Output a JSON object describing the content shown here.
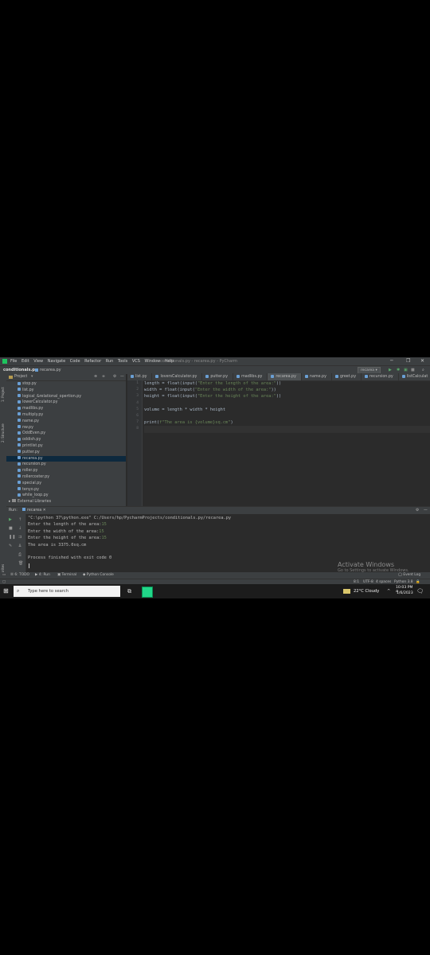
{
  "window": {
    "title": "conditionals.py - recarea.py - PyCharm",
    "menu": [
      "File",
      "Edit",
      "View",
      "Navigate",
      "Code",
      "Refactor",
      "Run",
      "Tools",
      "VCS",
      "Window",
      "Help"
    ]
  },
  "navbar": {
    "project": "conditionals.py",
    "file": "recarea.py",
    "run_config": "recarea"
  },
  "left_strip": {
    "project_label": "1: Project",
    "structure_label": "2: Structure",
    "favorites_label": "2: Favorites"
  },
  "project_panel": {
    "title": "Project",
    "files": [
      "stop.py",
      "list.py",
      "logical_&relational_opertion.py",
      "lowerCalculator.py",
      "madlibs.py",
      "multiply.py",
      "name.py",
      "nw.py",
      "OddEven.py",
      "oddish.py",
      "printlist.py",
      "putter.py",
      "recarea.py",
      "recursion.py",
      "roller.py",
      "rollercoster.py",
      "special.py",
      "tenyo.py",
      "while_loop.py"
    ],
    "selected": "recarea.py",
    "external": "External Libraries"
  },
  "tabs": [
    "list.py",
    "loversCalculator.py",
    "putter.py",
    "madlibs.py",
    "recarea.py",
    "name.py",
    "greet.py",
    "recursion.py",
    "listCalculat"
  ],
  "active_tab": "recarea.py",
  "editor": {
    "line_numbers": [
      "1",
      "2",
      "3",
      "4",
      "5",
      "6",
      "7",
      "8"
    ],
    "lines": [
      [
        "length = float(input(",
        "\"Enter the length of the area:\"",
        "))"
      ],
      [
        "width = float(input(",
        "\"Enter the width of the area:\"",
        "))"
      ],
      [
        "height = float(input(",
        "\"Enter the height of the area:\"",
        "))"
      ],
      [
        "",
        "",
        ""
      ],
      [
        "volume = length * width * height",
        "",
        ""
      ],
      [
        "",
        "",
        ""
      ],
      [
        "print(",
        "f\"The area is {volume}sq.cm\"",
        ")"
      ],
      [
        "",
        "",
        ""
      ]
    ]
  },
  "run_panel": {
    "label": "Run:",
    "config": "recarea",
    "output": [
      {
        "text": "\"C:\\python 37\\python.exe\" C:/Users/hp/PycharmProjects/conditionals.py/recarea.py",
        "input": ""
      },
      {
        "text": "Enter the length of the area:",
        "input": "15"
      },
      {
        "text": "Enter the width of the area:",
        "input": "15"
      },
      {
        "text": "Enter the height of the area:",
        "input": "15"
      },
      {
        "text": "The area is 3375.0sq.cm",
        "input": ""
      },
      {
        "text": "",
        "input": ""
      },
      {
        "text": "Process finished with exit code 0",
        "input": ""
      }
    ]
  },
  "bottom_tabs": [
    "6: TODO",
    "4: Run",
    "Terminal",
    "Python Console"
  ],
  "event_log": "Event Log",
  "status": {
    "position": "8:1",
    "encoding": "UTF-8",
    "indent": "4 spaces",
    "interpreter": "Python 3.8"
  },
  "watermark": {
    "title": "Activate Windows",
    "subtitle": "Go to Settings to activate Windows."
  },
  "taskbar": {
    "search_placeholder": "Type here to search",
    "weather": "22°C  Cloudy",
    "time": "10:03 PM",
    "date": "1/6/2023"
  }
}
